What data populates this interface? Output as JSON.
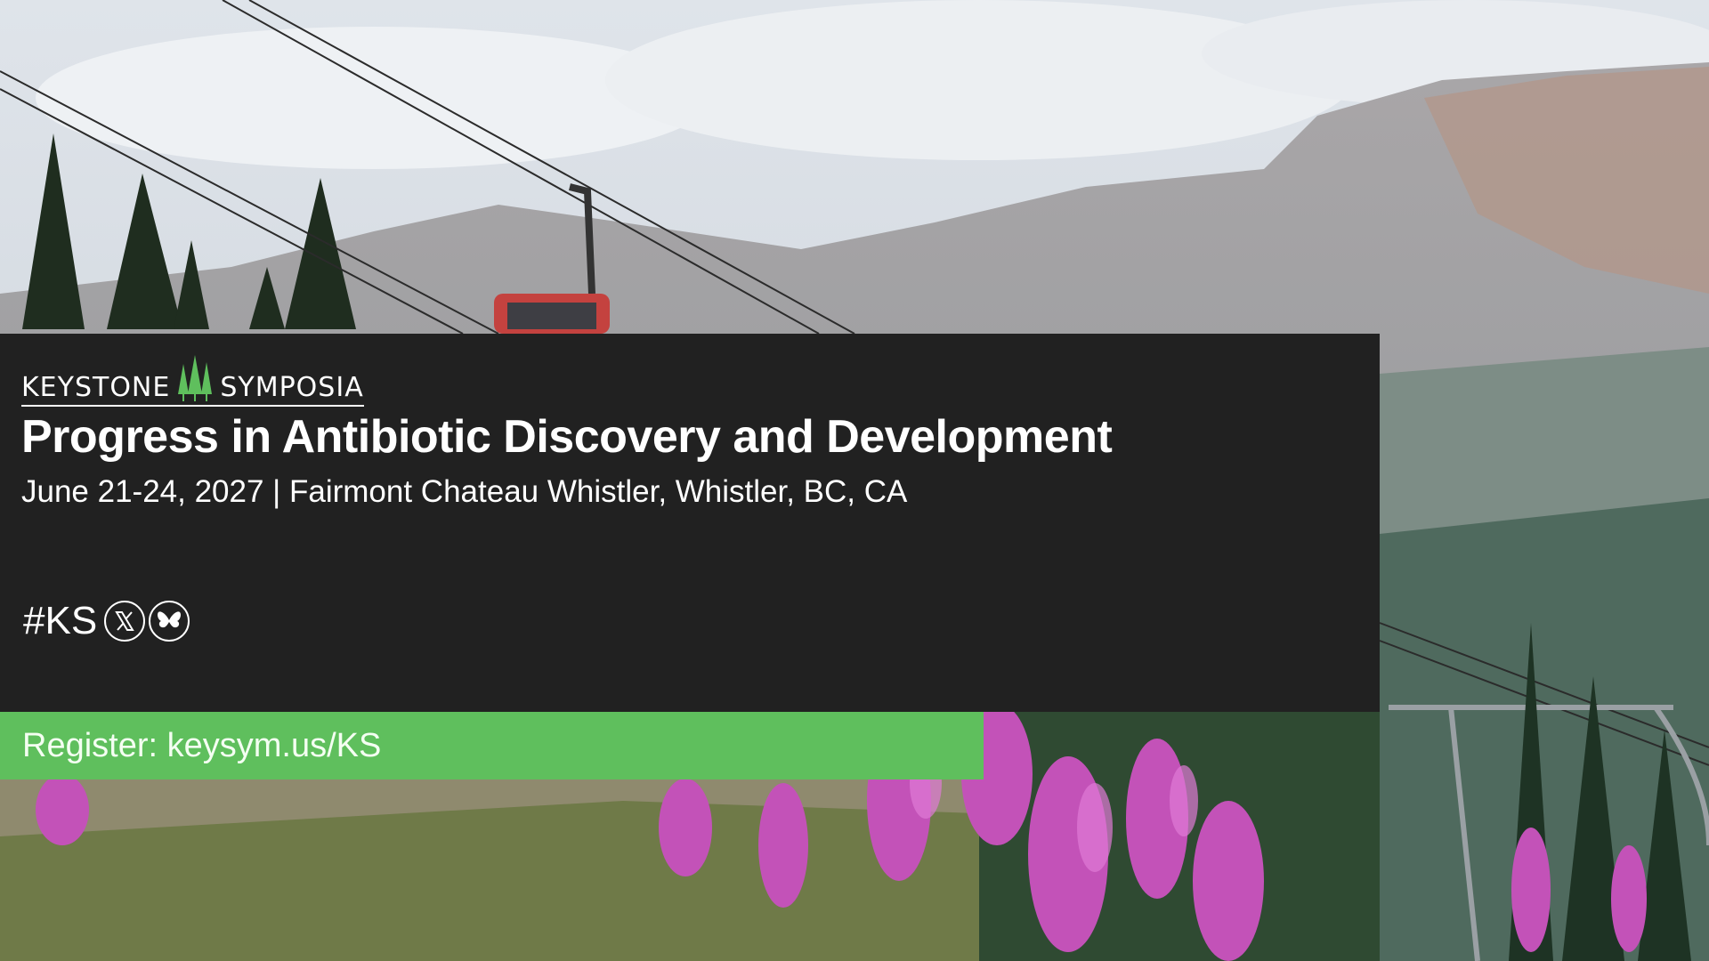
{
  "brand": {
    "name_left": "KEYSTONE",
    "name_right": "SYMPOSIA",
    "logo_icon": "pine-trees-icon",
    "accent_color": "#5fbf5d"
  },
  "event": {
    "title": "Progress in Antibiotic Discovery and Development",
    "details": "June 21-24, 2027 | Fairmont Chateau Whistler, Whistler, BC, CA"
  },
  "social": {
    "hashtag": "#KS",
    "icons": [
      "x-logo-icon",
      "bluesky-butterfly-icon"
    ]
  },
  "register": {
    "text": "Register: keysym.us/KS",
    "color": "#5fbf5d"
  },
  "colors": {
    "panel": "#212121",
    "text": "#ffffff"
  }
}
